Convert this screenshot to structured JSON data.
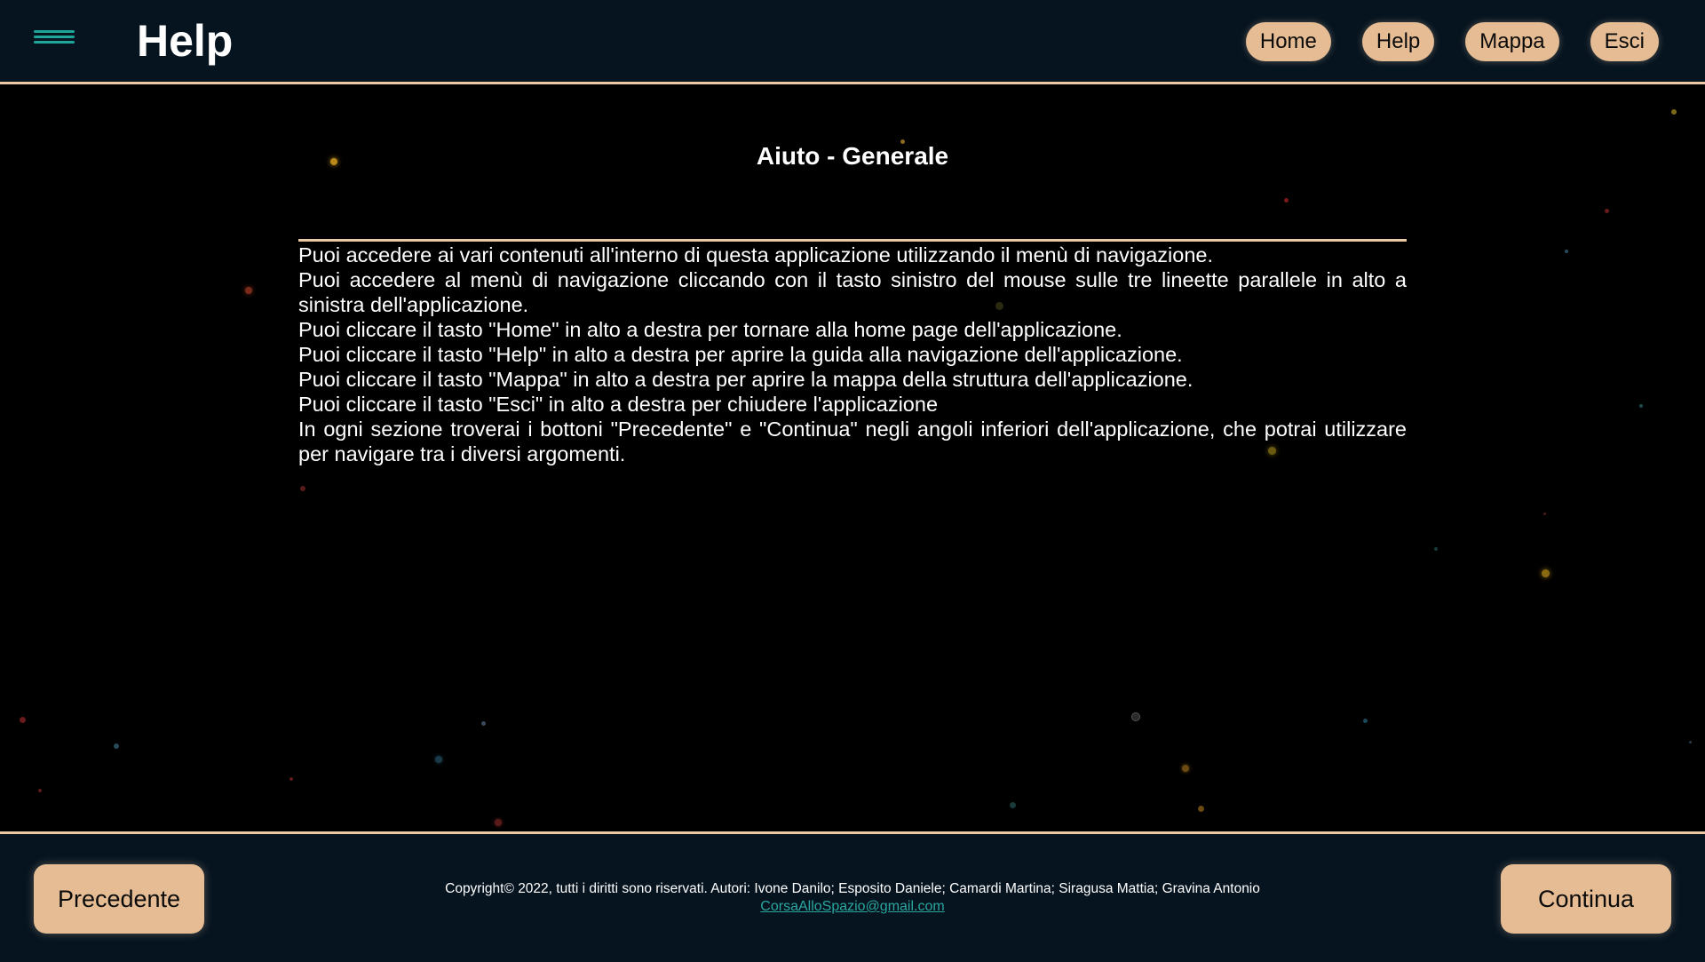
{
  "header": {
    "title": "Help",
    "menu_icon": "hamburger-menu-icon",
    "nav": [
      {
        "label": "Home"
      },
      {
        "label": "Help"
      },
      {
        "label": "Mappa"
      },
      {
        "label": "Esci"
      }
    ]
  },
  "main": {
    "section_title": "Aiuto - Generale",
    "paragraphs": [
      "Puoi accedere ai vari contenuti all'interno di questa applicazione utilizzando il menù di navigazione.",
      "Puoi accedere al menù di navigazione cliccando con il tasto sinistro del mouse sulle tre lineette parallele in alto a sinistra dell'applicazione.",
      "Puoi cliccare il tasto \"Home\" in alto a destra per tornare alla home page dell'applicazione.",
      "Puoi cliccare il tasto \"Help\" in alto a destra per aprire la guida alla navigazione dell'applicazione.",
      "Puoi cliccare il tasto \"Mappa\" in alto a destra per aprire la mappa della struttura dell'applicazione.",
      "Puoi cliccare il tasto \"Esci\" in alto a destra per chiudere l'applicazione",
      "In ogni sezione troverai i bottoni \"Precedente\" e \"Continua\" negli angoli inferiori dell'applicazione, che potrai utilizzare per navigare tra i diversi argomenti."
    ]
  },
  "footer": {
    "prev_label": "Precedente",
    "next_label": "Continua",
    "copyright": "Copyright© 2022, tutti i diritti sono riservati. Autori: Ivone Danilo; Esposito Daniele; Camardi Martina; Siragusa Mattia; Gravina Antonio",
    "email": "CorsaAlloSpazio@gmail.com"
  },
  "colors": {
    "header_bg": "#061420",
    "accent": "#e9c8a3",
    "button_bg": "#e5bc93",
    "menu_icon": "#1fa59a",
    "link": "#2aa69e"
  }
}
